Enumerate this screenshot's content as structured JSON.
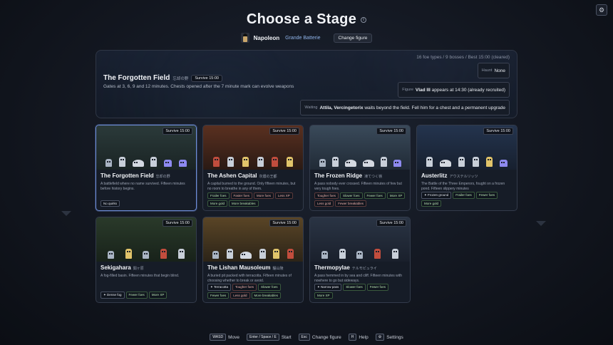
{
  "page": {
    "title": "Choose a Stage",
    "settings_icon": "gear-icon"
  },
  "figure": {
    "name": "Napoleon",
    "subtitle": "Grande Batterie",
    "change_label": "Change figure"
  },
  "hero": {
    "stats": "16 foe types / 9 bosses / Best 15:00 (cleared)",
    "name": "The Forgotten Field",
    "name_jp": "忘却の野",
    "survive": "Survive 15:00",
    "desc": "Gates at 3, 6, 9 and 12 minutes. Chests opened after the 7 minute mark can evolve weapons",
    "haunt_k": "Haunt",
    "haunt_v": "None",
    "figure_k": "Figure",
    "figure_v": "Vlad III",
    "figure_rest": "appears at 14:30 (already recruited)",
    "waits_k": "Waiting",
    "waits_v": "Attila, Vercingetorix",
    "waits_rest": "waits beyond the field. Fell him for a chest and a permanent upgrade"
  },
  "stages": [
    {
      "name": "The Forgotten Field",
      "jp": "忘却の野",
      "survive": "Survive 15:00",
      "desc": "A battlefield where no name survived. Fifteen minutes before history begins.",
      "tags": [
        {
          "t": "No quirks",
          "c": "neu"
        }
      ],
      "bg": "#2b3a3a",
      "bg2": "#1a2424"
    },
    {
      "name": "The Ashen Capital",
      "jp": "灰燼の王都",
      "survive": "Survive 15:00",
      "desc": "A capital burned to the ground. Only fifteen minutes, but no room to breathe in any of them.",
      "tags": [
        {
          "t": "Frailer foes",
          "c": "good"
        },
        {
          "t": "Faster foes",
          "c": "bad"
        },
        {
          "t": "More foes",
          "c": "bad"
        },
        {
          "t": "Less XP",
          "c": "bad"
        },
        {
          "t": "More gold",
          "c": "good"
        },
        {
          "t": "More breakables",
          "c": "good"
        }
      ],
      "bg": "#5a3020",
      "bg2": "#2a1a14"
    },
    {
      "name": "The Frozen Ridge",
      "jp": "凍てつく嶺",
      "survive": "Survive 15:00",
      "desc": "A pass nobody ever crossed. Fifteen minutes of few but very tough foes.",
      "tags": [
        {
          "t": "Tougher foes",
          "c": "bad"
        },
        {
          "t": "Slower foes",
          "c": "good"
        },
        {
          "t": "Fewer foes",
          "c": "good"
        },
        {
          "t": "More XP",
          "c": "good"
        },
        {
          "t": "Less gold",
          "c": "bad"
        },
        {
          "t": "Fewer breakables",
          "c": "bad"
        }
      ],
      "bg": "#3a4a5a",
      "bg2": "#202a36"
    },
    {
      "name": "Austerlitz",
      "jp": "アウステルリッツ",
      "survive": "Survive 15:00",
      "desc": "The Battle of the Three Emperors, fought on a frozen pond. Fifteen slippery minutes",
      "tags": [
        {
          "t": "✦ Frozen ground",
          "c": "neu"
        },
        {
          "t": "Frailer foes",
          "c": "good"
        },
        {
          "t": "Fewer foes",
          "c": "good"
        },
        {
          "t": "More gold",
          "c": "good"
        }
      ],
      "bg": "#24344e",
      "bg2": "#17202f"
    },
    {
      "name": "Sekigahara",
      "jp": "関ヶ原",
      "survive": "Survive 15:00",
      "desc": "A fog-filled basin. Fifteen minutes that begin blind.",
      "tags": [
        {
          "t": "✦ Dense fog",
          "c": "neu"
        },
        {
          "t": "Fewer foes",
          "c": "good"
        },
        {
          "t": "More XP",
          "c": "good"
        }
      ],
      "bg": "#2a3a2a",
      "bg2": "#18221a"
    },
    {
      "name": "The Lishan Mausoleum",
      "jp": "驪山陵",
      "survive": "Survive 15:00",
      "desc": "A buried pit packed with terracotta. Fifteen minutes of choosing whether to break or avoid.",
      "tags": [
        {
          "t": "✦ Terracotta",
          "c": "neu"
        },
        {
          "t": "Tougher foes",
          "c": "bad"
        },
        {
          "t": "Slower foes",
          "c": "good"
        },
        {
          "t": "Fewer foes",
          "c": "good"
        },
        {
          "t": "Less gold",
          "c": "bad"
        },
        {
          "t": "More breakables",
          "c": "good"
        }
      ],
      "bg": "#5a4526",
      "bg2": "#2c2418"
    },
    {
      "name": "Thermopylae",
      "jp": "テルモピュライ",
      "survive": "Survive 15:00",
      "desc": "A pass hemmed in by sea and cliff. Fifteen minutes with nowhere to go but sideways.",
      "tags": [
        {
          "t": "✦ Narrow pass",
          "c": "neu"
        },
        {
          "t": "Slower foes",
          "c": "good"
        },
        {
          "t": "Fewer foes",
          "c": "good"
        },
        {
          "t": "More XP",
          "c": "good"
        }
      ],
      "bg": "#2a3444",
      "bg2": "#1a202c"
    }
  ],
  "hints": [
    {
      "key": "WASD",
      "label": "Move"
    },
    {
      "key": "Enter / Space / E",
      "label": "Start"
    },
    {
      "key": "Esc",
      "label": "Change figure"
    },
    {
      "key": "H",
      "label": "Help"
    },
    {
      "key": "⚙",
      "label": "Settings"
    }
  ]
}
